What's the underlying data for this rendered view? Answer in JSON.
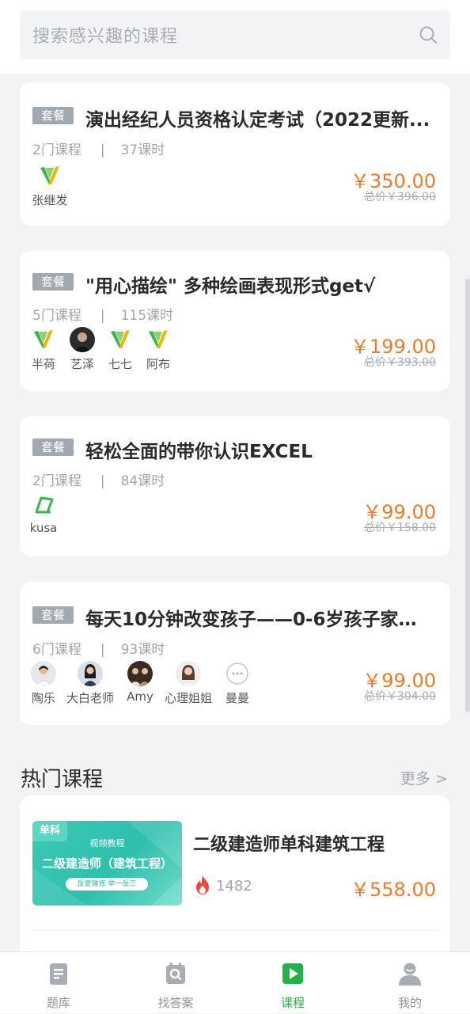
{
  "search": {
    "placeholder": "搜索感兴趣的课程"
  },
  "bundles": [
    {
      "tag": "套餐",
      "title": "演出经纪人员资格认定考试（2022更新...",
      "course_count": "2门课程",
      "separator": "|",
      "lesson_count": "37课时",
      "teachers": [
        {
          "name": "张继发",
          "icon": "green-v-logo-icon"
        }
      ],
      "price": "￥350.00",
      "original_price": "总价￥396.00"
    },
    {
      "tag": "套餐",
      "title": "\"用心描绘\" 多种绘画表现形式get√",
      "course_count": "5门课程",
      "separator": "|",
      "lesson_count": "115课时",
      "teachers": [
        {
          "name": "半荷",
          "icon": "green-v-logo-icon"
        },
        {
          "name": "艺泽",
          "icon": "photo-avatar"
        },
        {
          "name": "七七",
          "icon": "green-v-logo-icon"
        },
        {
          "name": "阿布",
          "icon": "green-v-logo-icon"
        }
      ],
      "price": "￥199.00",
      "original_price": "总价￥393.00"
    },
    {
      "tag": "套餐",
      "title": "轻松全面的带你认识EXCEL",
      "course_count": "2门课程",
      "separator": "|",
      "lesson_count": "84课时",
      "teachers": [
        {
          "name": "kusa",
          "icon": "green-leaf-logo-icon"
        }
      ],
      "price": "￥99.00",
      "original_price": "总价￥158.00"
    },
    {
      "tag": "套餐",
      "title": "每天10分钟改变孩子——0-6岁孩子家庭...",
      "course_count": "6门课程",
      "separator": "|",
      "lesson_count": "93课时",
      "teachers": [
        {
          "name": "陶乐",
          "icon": "photo-avatar"
        },
        {
          "name": "大白老师",
          "icon": "photo-avatar"
        },
        {
          "name": "Amy",
          "icon": "photo-avatar"
        },
        {
          "name": "心理姐姐",
          "icon": "photo-avatar"
        },
        {
          "name": "曼曼",
          "icon": "more-dots-icon"
        }
      ],
      "price": "￥99.00",
      "original_price": "总价￥304.00"
    }
  ],
  "hot_section": {
    "title": "热门课程",
    "more": "更多 >",
    "course": {
      "thumb_badge": "单科",
      "thumb_subtitle": "视频教程",
      "thumb_title": "二级建造师（建筑工程）",
      "thumb_tagline": "反复锤炼 举一反三",
      "title": "二级建造师单科建筑工程",
      "views": "1482",
      "price": "￥558.00"
    }
  },
  "tabbar": {
    "items": [
      {
        "label": "题库",
        "icon": "document-icon"
      },
      {
        "label": "找答案",
        "icon": "search-doc-icon"
      },
      {
        "label": "课程",
        "icon": "play-icon"
      },
      {
        "label": "我的",
        "icon": "user-icon"
      }
    ],
    "active_index": 2,
    "active_color": "#24b14a"
  },
  "colors": {
    "price": "#ee7a2c",
    "tag_bg": "#a1a8b2",
    "accent": "#24b14a"
  }
}
